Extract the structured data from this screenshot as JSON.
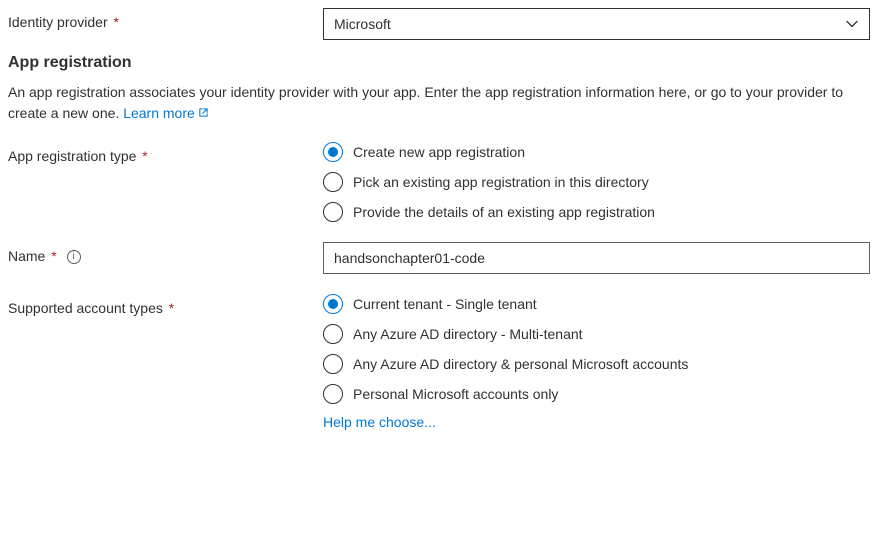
{
  "identity_provider": {
    "label": "Identity provider",
    "value": "Microsoft"
  },
  "section": {
    "heading": "App registration",
    "description": "An app registration associates your identity provider with your app. Enter the app registration information here, or go to your provider to create a new one. ",
    "learn_more": "Learn more"
  },
  "registration_type": {
    "label": "App registration type",
    "options": {
      "create": "Create new app registration",
      "pick": "Pick an existing app registration in this directory",
      "provide": "Provide the details of an existing app registration"
    }
  },
  "name": {
    "label": "Name",
    "value": "handsonchapter01-code"
  },
  "account_types": {
    "label": "Supported account types",
    "options": {
      "single": "Current tenant - Single tenant",
      "multi": "Any Azure AD directory - Multi-tenant",
      "multi_personal": "Any Azure AD directory & personal Microsoft accounts",
      "personal": "Personal Microsoft accounts only"
    },
    "help_link": "Help me choose..."
  }
}
